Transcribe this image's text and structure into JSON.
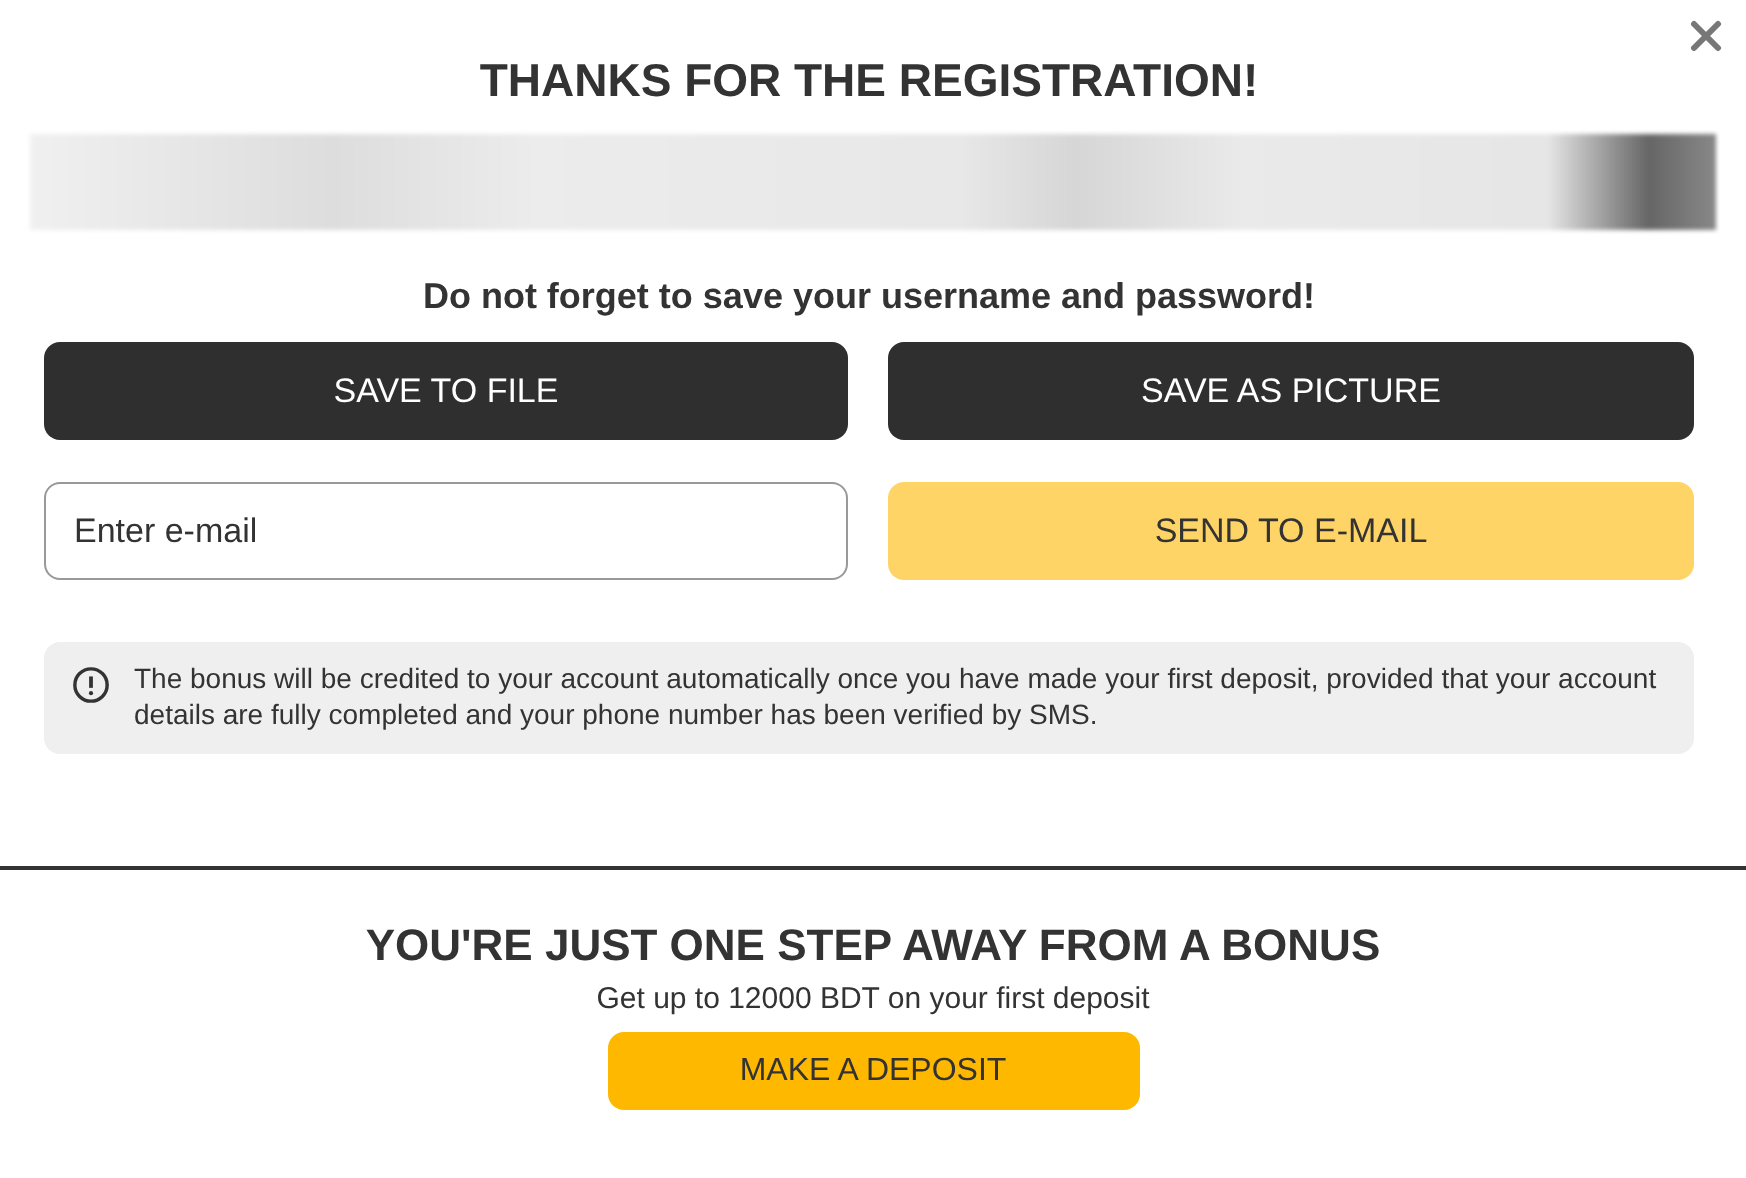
{
  "dialog": {
    "title": "THANKS FOR THE REGISTRATION!",
    "reminder": "Do not forget to save your username and password!",
    "save_buttons": [
      "SAVE TO FILE",
      "SAVE AS PICTURE"
    ],
    "email_field": {
      "placeholder": "Enter e-mail"
    },
    "send_button": "SEND TO E-MAIL",
    "notice": "The bonus will be credited to your account automatically once you have made your first deposit, provided that your account details are fully completed and your phone number has been verified by SMS."
  },
  "bonus": {
    "title": "YOU'RE JUST ONE STEP AWAY FROM A BONUS",
    "subtitle": "Get up to 12000 BDT on your first deposit",
    "button": "MAKE A DEPOSIT"
  }
}
